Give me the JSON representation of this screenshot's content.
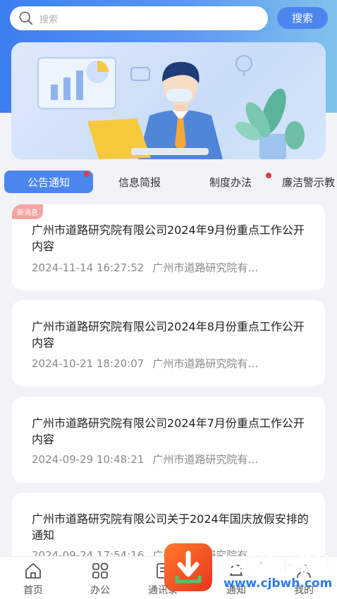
{
  "search": {
    "placeholder": "搜索",
    "button_label": "搜索"
  },
  "tabs": [
    {
      "label": "公告通知",
      "active": true,
      "has_dot": true
    },
    {
      "label": "信息简报",
      "active": false,
      "has_dot": false
    },
    {
      "label": "制度办法",
      "active": false,
      "has_dot": true
    },
    {
      "label": "廉洁警示教",
      "active": false,
      "has_dot": false
    }
  ],
  "notices": [
    {
      "tag": "新消息",
      "title": "广州市道路研究院有限公司2024年9月份重点工作公开内容",
      "date": "2024-11-14 16:27:52",
      "source": "广州市道路研究院有…"
    },
    {
      "tag": "",
      "title": "广州市道路研究院有限公司2024年8月份重点工作公开内容",
      "date": "2024-10-21 18:20:07",
      "source": "广州市道路研究院有…"
    },
    {
      "tag": "",
      "title": "广州市道路研究院有限公司2024年7月份重点工作公开内容",
      "date": "2024-09-29 10:48:21",
      "source": "广州市道路研究院有…"
    },
    {
      "tag": "",
      "title": "广州市道路研究院有限公司关于2024年国庆放假安排的通知",
      "date": "2024-09-24 17:54:16",
      "source": "广州市道路研究院有"
    }
  ],
  "bottom_nav": [
    {
      "label": "首页",
      "icon": "home-icon"
    },
    {
      "label": "办公",
      "icon": "grid-icon"
    },
    {
      "label": "通讯录",
      "icon": "contacts-icon"
    },
    {
      "label": "通知",
      "icon": "bell-icon"
    },
    {
      "label": "我的",
      "icon": "user-icon"
    }
  ],
  "watermark": {
    "title": "超级棒下载站",
    "url": "www.cjbwh.com"
  },
  "colors": {
    "accent": "#4a86ee",
    "badge": "#e23c3c",
    "new_tag": "#f8a2a2"
  }
}
